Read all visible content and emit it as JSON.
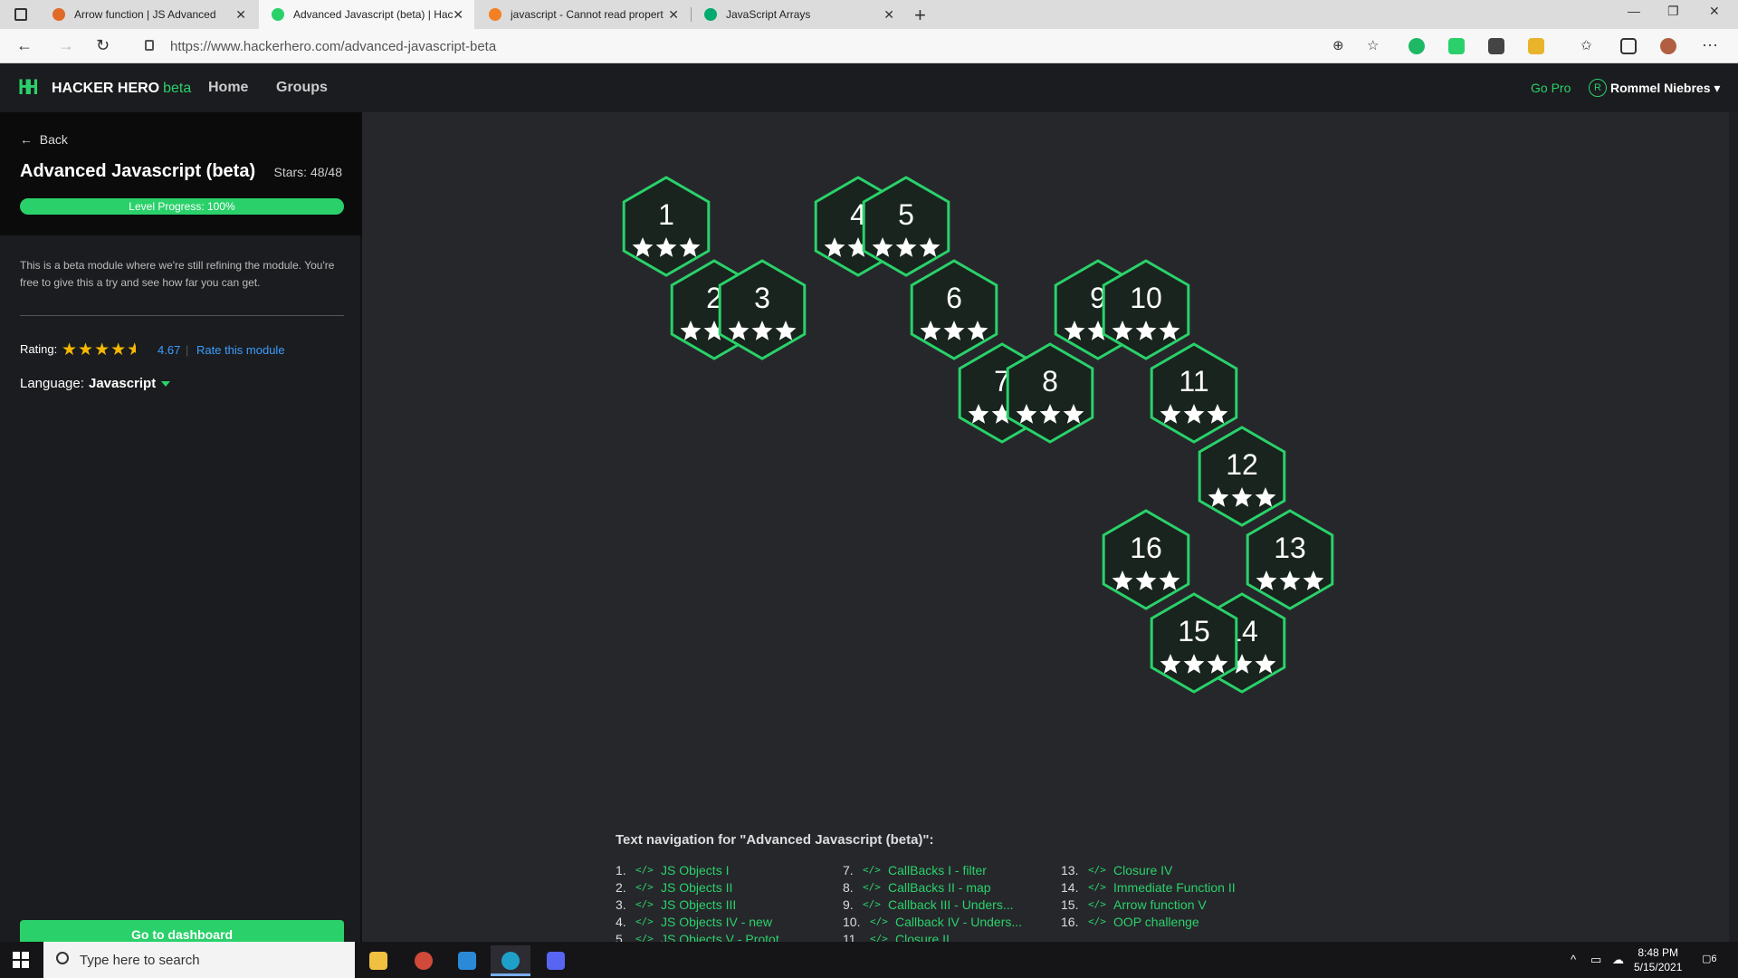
{
  "browser": {
    "tabs": [
      {
        "title": "Arrow function | JS Advanced",
        "favicon_color": "#e06a28"
      },
      {
        "title": "Advanced Javascript (beta) | Hac",
        "favicon_color": "#2ad16a"
      },
      {
        "title": "javascript - Cannot read propert",
        "favicon_color": "#f48024"
      },
      {
        "title": "JavaScript Arrays",
        "favicon_color": "#04aa6d"
      }
    ],
    "url": "https://www.hackerhero.com/advanced-javascript-beta"
  },
  "header": {
    "brand": "HACKER HERO",
    "brand_suffix": "beta",
    "nav": [
      "Home",
      "Groups"
    ],
    "go_pro": "Go Pro",
    "user_initial": "R",
    "user_name": "Rommel Niebres ▾"
  },
  "sidebar": {
    "back": "Back",
    "title": "Advanced Javascript (beta)",
    "stars": "Stars: 48/48",
    "progress_label": "Level Progress: 100%",
    "progress_fraction": 1.0,
    "description": "This is a beta module where we're still refining the module. You're free to give this a try and see how far you can get.",
    "rating_label": "Rating:",
    "rating_value": "4.67",
    "rate_link": "Rate this module",
    "language_label": "Language:",
    "language_value": "Javascript",
    "dashboard_button": "Go to dashboard"
  },
  "map": {
    "stars_per_level": 3,
    "levels": [
      {
        "label": "1",
        "stars": 3
      },
      {
        "label": "2",
        "stars": 3
      },
      {
        "label": "3",
        "stars": 3
      },
      {
        "label": "4",
        "stars": 3
      },
      {
        "label": "5",
        "stars": 3
      },
      {
        "label": "6",
        "stars": 3
      },
      {
        "label": "7",
        "stars": 3
      },
      {
        "label": "8",
        "stars": 3
      },
      {
        "label": "9",
        "stars": 3
      },
      {
        "label": "10",
        "stars": 3
      },
      {
        "label": "11",
        "stars": 3
      },
      {
        "label": "12",
        "stars": 3
      },
      {
        "label": "13",
        "stars": 3
      },
      {
        "label": "14",
        "stars": 3
      },
      {
        "label": "15",
        "stars": 3
      },
      {
        "label": "16",
        "stars": 3
      }
    ]
  },
  "text_nav": {
    "title": "Text navigation for \"Advanced Javascript (beta)\":",
    "items": [
      {
        "num": "1.",
        "label": "JS Objects I"
      },
      {
        "num": "2.",
        "label": "JS Objects II"
      },
      {
        "num": "3.",
        "label": "JS Objects III"
      },
      {
        "num": "4.",
        "label": "JS Objects IV - new"
      },
      {
        "num": "5.",
        "label": "JS Objects V - Protot..."
      },
      {
        "num": "7.",
        "label": "CallBacks I - filter"
      },
      {
        "num": "8.",
        "label": "CallBacks II - map"
      },
      {
        "num": "9.",
        "label": "Callback III - Unders..."
      },
      {
        "num": "10.",
        "label": "Callback IV - Unders..."
      },
      {
        "num": "11.",
        "label": "Closure II"
      },
      {
        "num": "13.",
        "label": "Closure IV"
      },
      {
        "num": "14.",
        "label": "Immediate Function II"
      },
      {
        "num": "15.",
        "label": "Arrow function V"
      },
      {
        "num": "16.",
        "label": "OOP challenge"
      }
    ]
  },
  "taskbar": {
    "search_placeholder": "Type here to search",
    "time": "8:48 PM",
    "date": "5/15/2021",
    "notifications": "6"
  },
  "colors": {
    "accent": "#2ad16a",
    "hex_fill": "#18241d",
    "link": "#3b9dff",
    "star_rating": "#f5b800"
  }
}
